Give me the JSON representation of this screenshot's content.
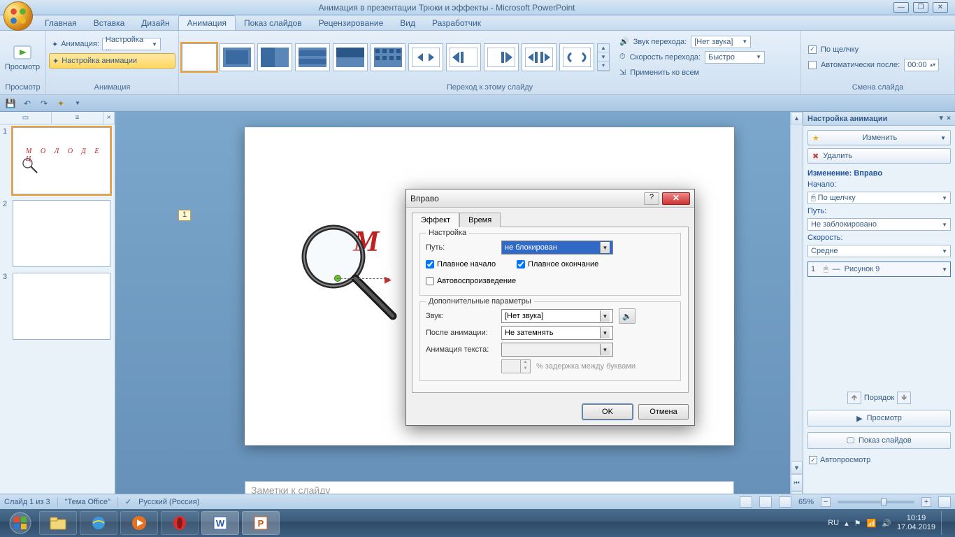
{
  "window": {
    "title": "Анимация в презентации Трюки и эффекты - Microsoft PowerPoint"
  },
  "tabs": {
    "home": "Главная",
    "insert": "Вставка",
    "design": "Дизайн",
    "animation": "Анимация",
    "slideshow": "Показ слайдов",
    "review": "Рецензирование",
    "view": "Вид",
    "developer": "Разработчик"
  },
  "ribbon": {
    "preview_group": "Просмотр",
    "preview_btn": "Просмотр",
    "anim_group": "Анимация",
    "anim_label": "Анимация:",
    "anim_value": "Настройка ...",
    "custom_anim": "Настройка анимации",
    "transition_group": "Переход к этому слайду",
    "sound_label": "Звук перехода:",
    "sound_value": "[Нет звука]",
    "speed_label": "Скорость перехода:",
    "speed_value": "Быстро",
    "apply_all": "Применить ко всем",
    "advance_group": "Смена слайда",
    "on_click": "По щелчку",
    "auto_after": "Автоматически после:",
    "auto_time": "00:00"
  },
  "slide": {
    "text": "М О Л О Д Е Ц",
    "short": "М  О  Л",
    "label": "1"
  },
  "notes": {
    "placeholder": "Заметки к слайду"
  },
  "anim_pane": {
    "title": "Настройка анимации",
    "change": "Изменить",
    "remove": "Удалить",
    "modify": "Изменение: Вправо",
    "start_label": "Начало:",
    "start_value": "По щелчку",
    "path_label": "Путь:",
    "path_value": "Не заблокировано",
    "speed_label": "Скорость:",
    "speed_value": "Средне",
    "item_num": "1",
    "item_name": "Рисунок 9",
    "reorder": "Порядок",
    "play": "Просмотр",
    "slideshow": "Показ слайдов",
    "autopreview": "Автопросмотр"
  },
  "dialog": {
    "title": "Вправо",
    "tab_effect": "Эффект",
    "tab_time": "Время",
    "group_settings": "Настройка",
    "path_label": "Путь:",
    "path_value": "не блокирован",
    "smooth_start": "Плавное начало",
    "smooth_end": "Плавное окончание",
    "autoreverse": "Автовоспроизведение",
    "group_extra": "Дополнительные параметры",
    "sound_label": "Звук:",
    "sound_value": "[Нет звука]",
    "after_label": "После анимации:",
    "after_value": "Не затемнять",
    "text_anim_label": "Анимация текста:",
    "delay_label": "% задержка между буквами",
    "ok": "OK",
    "cancel": "Отмена"
  },
  "statusbar": {
    "slide": "Слайд 1 из 3",
    "theme": "\"Тема Office\"",
    "lang": "Русский (Россия)",
    "zoom": "65%"
  },
  "taskbar": {
    "lang": "RU",
    "time": "10:19",
    "date": "17.04.2019"
  }
}
